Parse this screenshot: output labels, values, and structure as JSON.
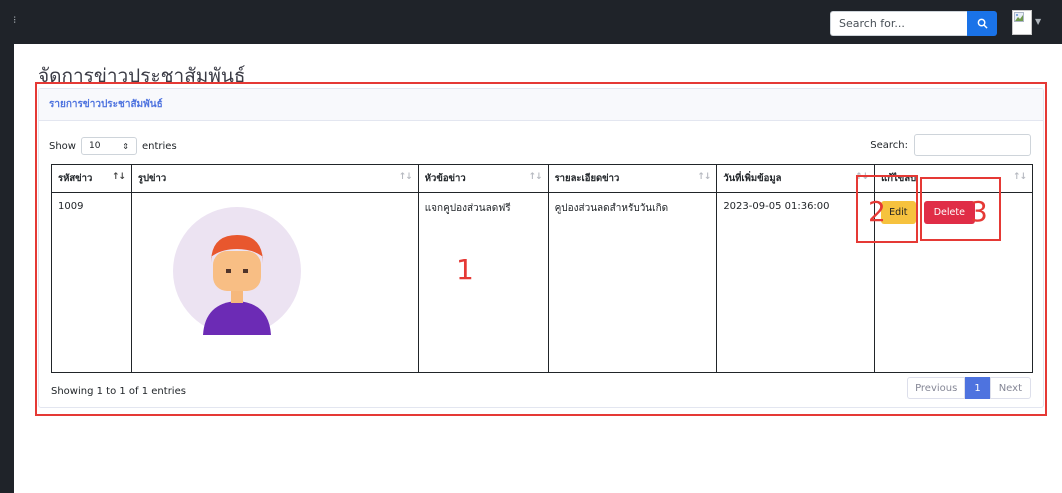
{
  "navbar": {
    "menu_icon": "hamburger-icon",
    "search_placeholder": "Search for...",
    "search_icon": "search-icon",
    "avatar_icon": "broken-image-icon"
  },
  "page_title": "จัดการข่าวประชาสัมพันธ์",
  "card": {
    "header_title": "รายการข่าวประชาสัมพันธ์",
    "show_label": "Show",
    "entries_label": "entries",
    "page_length": "10",
    "search_label": "Search:",
    "columns": [
      "รหัสข่าว",
      "รูปข่าว",
      "หัวข้อข่าว",
      "รายละเอียดข่าว",
      "วันที่เพิ่มข้อมูล",
      "แก้ไขลบ"
    ],
    "rows": [
      {
        "id": "1009",
        "image_icon": "user-avatar-icon",
        "title": "แจกคูปองส่วนลดฟรี",
        "detail": "คูปองส่วนลดสำหรับวันเกิด",
        "date_added": "2023-09-05 01:36:00",
        "edit_label": "Edit",
        "delete_label": "Delete"
      }
    ],
    "info_text": "Showing 1 to 1 of 1 entries",
    "pagination": {
      "previous": "Previous",
      "current": "1",
      "next": "Next"
    }
  },
  "annotations": {
    "one": "1",
    "two": "2",
    "three": "3"
  },
  "colors": {
    "navbar": "#1f2329",
    "primary": "#4e73df",
    "warning": "#f6c23e",
    "danger": "#e02d47",
    "annotation": "#e53935"
  }
}
